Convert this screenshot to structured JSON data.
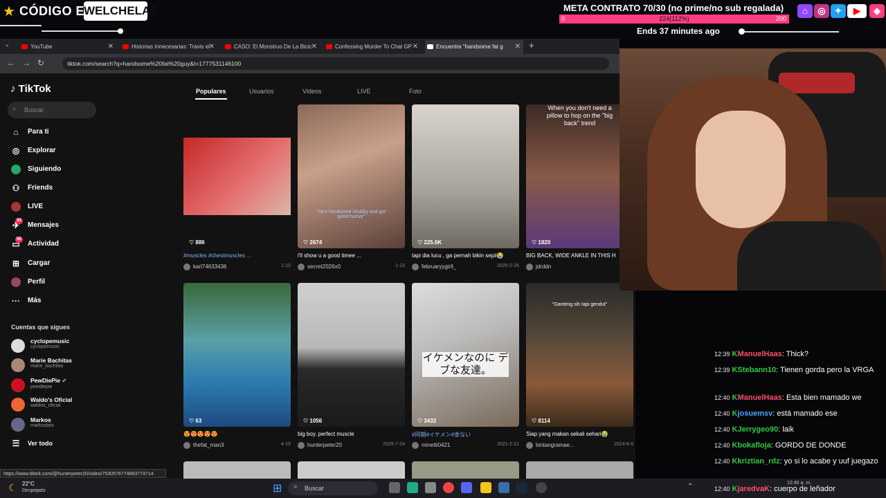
{
  "overlay": {
    "code_label": "CÓDIGO EPIC",
    "code_value": "WELCHELAS",
    "goal_title": "META CONTRATO 70/30 (no prime/no sub regalada)",
    "goal_min": "0",
    "goal_center": "224(112%)",
    "goal_max": "200",
    "goal_fraction": 1.12,
    "goal_ends": "Ends 37 minutes ago",
    "accent": "#ff3d7f"
  },
  "browser": {
    "tabs": [
      {
        "label": "YouTube"
      },
      {
        "label": "Historias Innecesarias: Travis el"
      },
      {
        "label": "CASO: El Monstruo De La Bicic"
      },
      {
        "label": "Confessing Murder To Chat GP"
      },
      {
        "label": "Encuentra \"handsome fat g"
      }
    ],
    "url": "tiktok.com/search?q=handsome%20fat%20guy&t=1777531146100",
    "status_url": "https://www.tiktok.com/@hunterpeter20/video/7530576774883773714"
  },
  "tiktok": {
    "logo": "TikTok",
    "search_placeholder": "Buscar",
    "nav": [
      {
        "label": "Para ti",
        "icon": "home-icon"
      },
      {
        "label": "Explorar",
        "icon": "compass-icon"
      },
      {
        "label": "Siguiendo",
        "icon": "following-icon"
      },
      {
        "label": "Friends",
        "icon": "friends-icon"
      },
      {
        "label": "LIVE",
        "icon": "live-icon"
      },
      {
        "label": "Mensajes",
        "icon": "messages-icon",
        "badge": "34"
      },
      {
        "label": "Actividad",
        "icon": "activity-icon",
        "badge": "56"
      },
      {
        "label": "Cargar",
        "icon": "upload-icon"
      },
      {
        "label": "Perfil",
        "icon": "profile-icon"
      },
      {
        "label": "Más",
        "icon": "more-icon"
      }
    ],
    "following_title": "Cuentas que sigues",
    "following": [
      {
        "name": "cyclopemusic",
        "handle": "cyclopemusic"
      },
      {
        "name": "Marie Bachitas",
        "handle": "marie_bachitas"
      },
      {
        "name": "PewDiePie",
        "handle": "pewdiepie"
      },
      {
        "name": "Waldo's Oficial",
        "handle": "waldos_oficial"
      },
      {
        "name": "Markos",
        "handle": "markosbits"
      }
    ],
    "see_all": "Ver todo",
    "tabs": [
      "Populares",
      "Usuarios",
      "Videos",
      "LIVE",
      "Foto"
    ],
    "videos": [
      {
        "likes": "886",
        "caption": "#muscles #chestmuscles ...",
        "user": "karl74633436",
        "date": "1-10"
      },
      {
        "likes": "2674",
        "caption": "i'll show u a good timee ...",
        "user": "secret2026x0",
        "date": "1-13",
        "overlay": "\"he's handsome chubby and got good humor\""
      },
      {
        "likes": "225.6K",
        "caption": "tapi dia lucu , ga pernah bikin sepii😭",
        "user": "februaryygirll_",
        "date": "2025-2-26"
      },
      {
        "likes": "1820",
        "caption": "BIG BACK, WIDE ANKLE IN THIS H",
        "user": "jdrddn",
        "date": "",
        "overlay": "When you don't need a pillow to hop on the \"big back\" trend"
      },
      {
        "likes": "63",
        "caption": "😍😍😍😍😍",
        "user": "thefat_man3",
        "date": "4-15"
      },
      {
        "likes": "1056",
        "caption": "big boy. perfect muscle",
        "user": "hunterpeter20",
        "date": "2025-7-24"
      },
      {
        "likes": "3432",
        "caption": "#同期#イケメン#金ない",
        "user": "minetti0421",
        "date": "2021-2-21",
        "overlay": "イケメンなのに デブな友達。"
      },
      {
        "likes": "8114",
        "caption": "Siap yang makan sekali sehari😭",
        "user": "bintangramae...",
        "date": "2024-6-9",
        "overlay": "\"Ganteng sih tapi gendut\""
      }
    ]
  },
  "chat": [
    {
      "time": "12:39",
      "user": "ManuelHaas",
      "color": "#ff4d6d",
      "msg": "Thick?"
    },
    {
      "time": "12:39",
      "user": "Stebann10",
      "color": "#2ecc40",
      "msg": "Tienen gorda pero la VRGA"
    },
    {
      "time": "12:40",
      "user": "ManuelHaas",
      "color": "#ff4d6d",
      "msg": "Esta bien mamado we"
    },
    {
      "time": "12:40",
      "user": "josuemsv",
      "color": "#4ea3ff",
      "msg": "está mamado ese"
    },
    {
      "time": "12:40",
      "user": "Jerrygeo90",
      "color": "#2ecc40",
      "msg": "laik"
    },
    {
      "time": "12:40",
      "user": "bokafloja",
      "color": "#2ecc40",
      "msg": "GORDO DE DONDE"
    },
    {
      "time": "12:40",
      "user": "kriztian_rdz",
      "color": "#2ecc40",
      "msg": "yo si lo acabe y uuf juegazo"
    },
    {
      "time": "12:40",
      "user": "jaredvaK",
      "color": "#ff4d6d",
      "msg": "cuerpo de leñador"
    }
  ],
  "taskbar": {
    "temp": "22°C",
    "weather": "Despejado",
    "search": "Buscar",
    "time": "12:40 a. m."
  }
}
